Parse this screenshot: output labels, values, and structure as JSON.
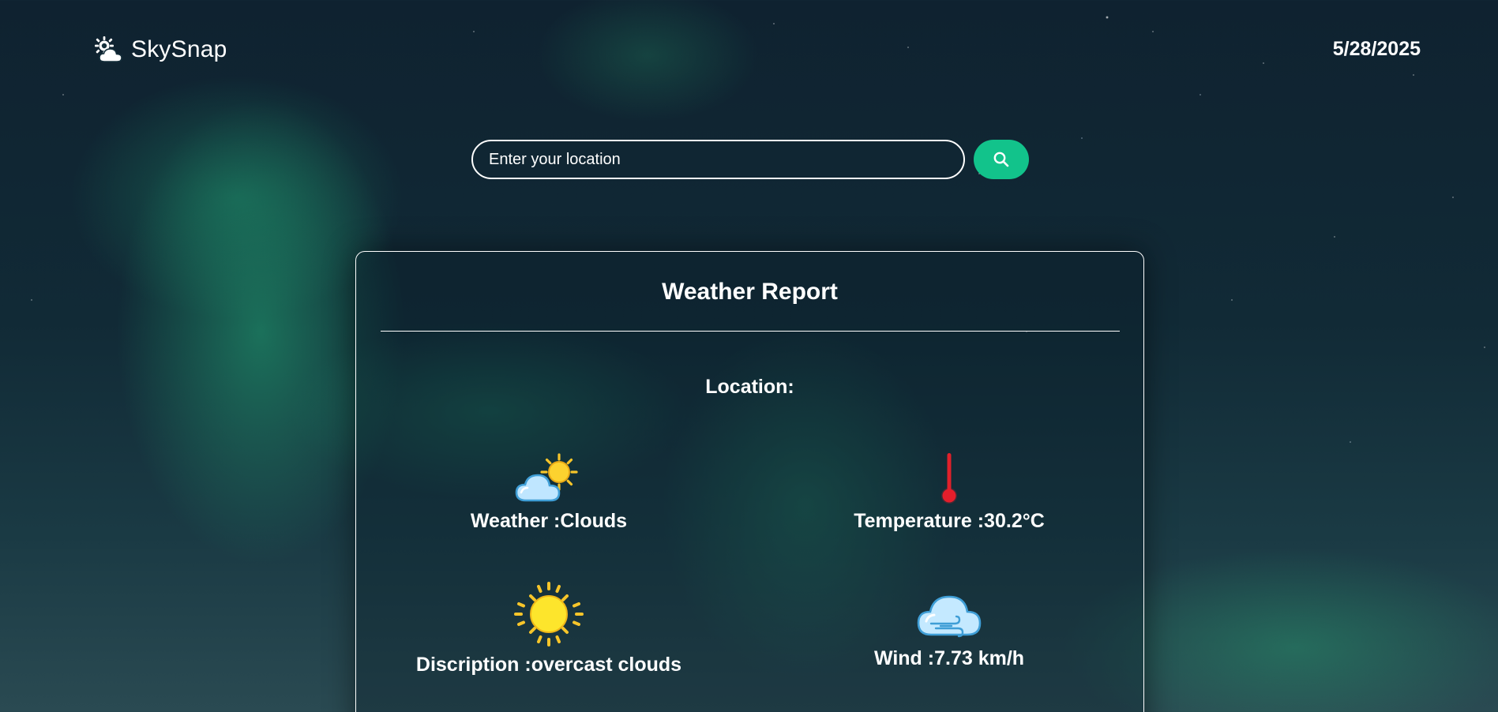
{
  "header": {
    "app_name": "SkySnap",
    "logo_icon": "sun-cloud-icon",
    "date": "5/28/2025"
  },
  "search": {
    "placeholder": "Enter your location",
    "value": "",
    "button_icon": "search-icon",
    "button_color": "#12c38b"
  },
  "report": {
    "title": "Weather Report",
    "location_label": "Location:",
    "items": [
      {
        "icon": "sun-behind-cloud-icon",
        "label": "Weather :Clouds"
      },
      {
        "icon": "thermometer-icon",
        "label": "Temperature :30.2°C"
      },
      {
        "icon": "sun-icon",
        "label": "Discription :overcast clouds"
      },
      {
        "icon": "wind-cloud-icon",
        "label": "Wind :7.73 km/h"
      }
    ]
  }
}
